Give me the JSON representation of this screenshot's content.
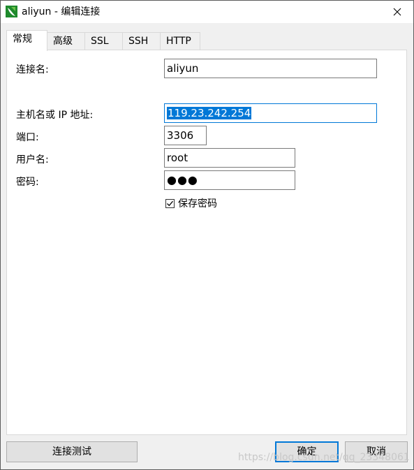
{
  "window": {
    "title": "aliyun - 编辑连接",
    "icon": "navicat-leaf-icon",
    "accent": "#0078d7"
  },
  "tabs": [
    {
      "label": "常规",
      "active": true
    },
    {
      "label": "高级",
      "active": false
    },
    {
      "label": "SSL",
      "active": false
    },
    {
      "label": "SSH",
      "active": false
    },
    {
      "label": "HTTP",
      "active": false
    }
  ],
  "form": {
    "connection_name": {
      "label": "连接名:",
      "value": "aliyun"
    },
    "host": {
      "label": "主机名或 IP 地址:",
      "value": "119.23.242.254"
    },
    "port": {
      "label": "端口:",
      "value": "3306"
    },
    "username": {
      "label": "用户名:",
      "value": "root"
    },
    "password": {
      "label": "密码:",
      "value": "●●●"
    },
    "save_password": {
      "label": "保存密码",
      "checked": true
    }
  },
  "buttons": {
    "test": "连接测试",
    "ok": "确定",
    "cancel": "取消"
  },
  "watermark": "https://blog.csdn.net/qq_23348061"
}
